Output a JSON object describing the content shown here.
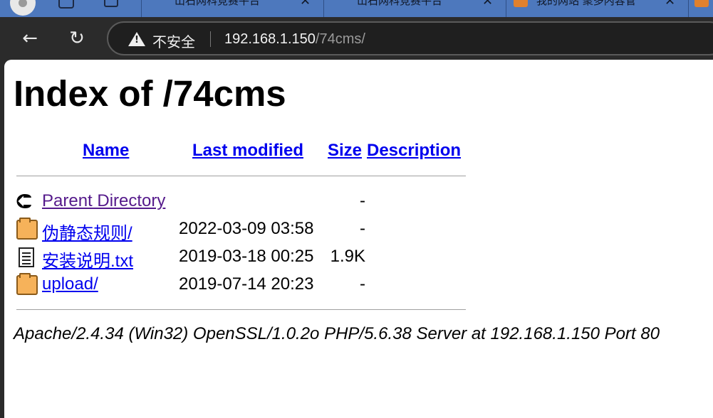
{
  "browser": {
    "tabs": [
      {
        "title": "山石网科竞赛平台"
      },
      {
        "title": "山石网科竞赛平台"
      },
      {
        "title": "我的网站 聚多内容管"
      }
    ],
    "security_label": "不安全",
    "url_host": "192.168.1.150",
    "url_path": "/74cms/"
  },
  "page": {
    "title": "Index of /74cms",
    "columns": {
      "name": "Name",
      "last_modified": "Last modified",
      "size": "Size",
      "description": "Description"
    },
    "entries": [
      {
        "icon": "back-arrow-icon",
        "name": "Parent Directory",
        "modified": "",
        "size": "-"
      },
      {
        "icon": "folder-icon",
        "name": "伪静态规则/",
        "modified": "2022-03-09 03:58",
        "size": "-"
      },
      {
        "icon": "text-file-icon",
        "name": "安装说明.txt",
        "modified": "2019-03-18 00:25",
        "size": "1.9K"
      },
      {
        "icon": "folder-icon",
        "name": "upload/",
        "modified": "2019-07-14 20:23",
        "size": "-"
      }
    ],
    "footer": "Apache/2.4.34 (Win32) OpenSSL/1.0.2o PHP/5.6.38 Server at 192.168.1.150 Port 80"
  }
}
